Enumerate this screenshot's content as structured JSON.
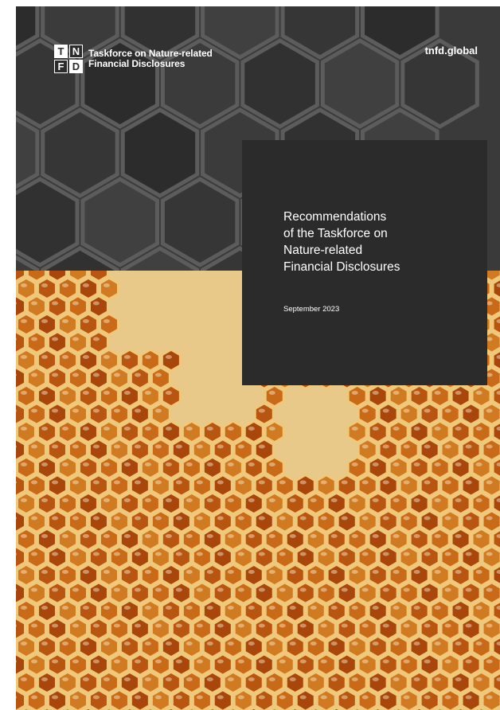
{
  "logo": {
    "letters": [
      "T",
      "N",
      "F",
      "D"
    ],
    "line1": "Taskforce on Nature-related",
    "line2": "Financial Disclosures"
  },
  "site_url": "tnfd.global",
  "title_lines": [
    "Recommendations",
    "of the Taskforce on",
    "Nature-related",
    "Financial Disclosures"
  ],
  "date": "September 2023",
  "colors": {
    "panel": "#2b2b2b",
    "building": "#3a3a3a",
    "honey": "#c9661b",
    "wax": "#e8c98a"
  }
}
